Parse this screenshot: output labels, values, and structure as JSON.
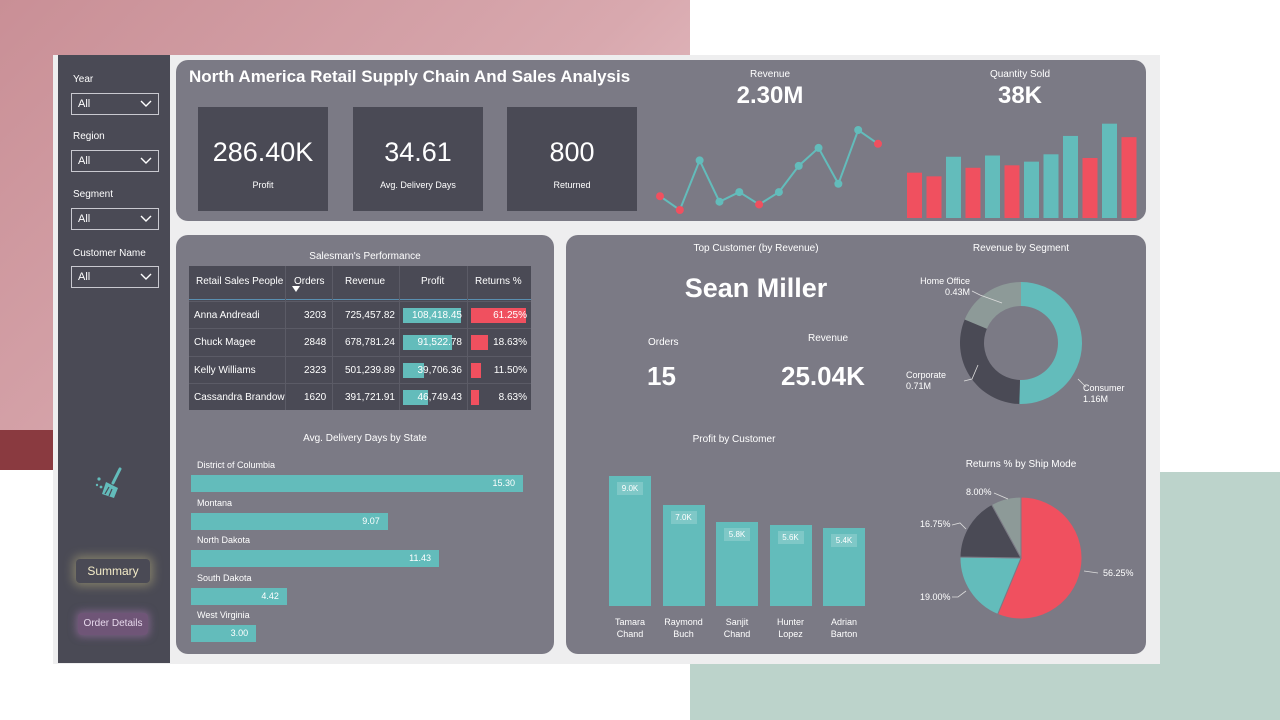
{
  "filters": [
    {
      "label": "Year",
      "value": "All"
    },
    {
      "label": "Region",
      "value": "All"
    },
    {
      "label": "Segment",
      "value": "All"
    },
    {
      "label": "Customer Name",
      "value": "All"
    }
  ],
  "nav": {
    "summary": "Summary",
    "order_details": "Order Details"
  },
  "header": {
    "title": "North America Retail Supply Chain And Sales Analysis",
    "kpis": [
      {
        "value": "286.40K",
        "label": "Profit"
      },
      {
        "value": "34.61",
        "label": "Avg. Delivery Days"
      },
      {
        "value": "800",
        "label": "Returned"
      }
    ],
    "revenue": {
      "label": "Revenue",
      "value": "2.30M"
    },
    "quantity": {
      "label": "Quantity Sold",
      "value": "38K"
    }
  },
  "revenue_trend": {
    "values": [
      3.0,
      2.0,
      5.6,
      2.6,
      3.3,
      2.4,
      3.3,
      5.2,
      6.5,
      3.9,
      7.8,
      6.8
    ],
    "colors": [
      "#f0505f",
      "#f0505f",
      "#63bcbb",
      "#63bcbb",
      "#63bcbb",
      "#f0505f",
      "#63bcbb",
      "#63bcbb",
      "#63bcbb",
      "#63bcbb",
      "#63bcbb",
      "#f0505f"
    ]
  },
  "quantity_bars": {
    "values": [
      37,
      34,
      50,
      41,
      51,
      43,
      46,
      52,
      67,
      49,
      77,
      66
    ],
    "colors": [
      "#f0505f",
      "#f0505f",
      "#63bcbb",
      "#f0505f",
      "#63bcbb",
      "#f0505f",
      "#63bcbb",
      "#63bcbb",
      "#63bcbb",
      "#f0505f",
      "#63bcbb",
      "#f0505f"
    ]
  },
  "salesman": {
    "title": "Salesman's Performance",
    "columns": [
      "Retail Sales People",
      "Orders",
      "Revenue",
      "Profit",
      "Returns %"
    ],
    "rows": [
      {
        "name": "Anna Andreadi",
        "orders": "3203",
        "revenue": "725,457.82",
        "profit": "108,418.45",
        "returns": "61.25%",
        "profit_frac": 1.0,
        "returns_frac": 1.0
      },
      {
        "name": "Chuck Magee",
        "orders": "2848",
        "revenue": "678,781.24",
        "profit": "91,522.78",
        "returns": "18.63%",
        "profit_frac": 0.84,
        "returns_frac": 0.3
      },
      {
        "name": "Kelly Williams",
        "orders": "2323",
        "revenue": "501,239.89",
        "profit": "39,706.36",
        "returns": "11.50%",
        "profit_frac": 0.37,
        "returns_frac": 0.19
      },
      {
        "name": "Cassandra Brandow",
        "orders": "1620",
        "revenue": "391,721.91",
        "profit": "46,749.43",
        "returns": "8.63%",
        "profit_frac": 0.43,
        "returns_frac": 0.14
      }
    ]
  },
  "delivery": {
    "title": "Avg. Delivery Days by State",
    "states": [
      {
        "name": "District of Columbia",
        "value": "15.30"
      },
      {
        "name": "Montana",
        "value": "9.07"
      },
      {
        "name": "North Dakota",
        "value": "11.43"
      },
      {
        "name": "South Dakota",
        "value": "4.42"
      },
      {
        "name": "West Virginia",
        "value": "3.00"
      }
    ],
    "max": 15.3
  },
  "top_customer": {
    "title": "Top Customer (by Revenue)",
    "name": "Sean Miller",
    "orders_label": "Orders",
    "orders": "15",
    "revenue_label": "Revenue",
    "revenue": "25.04K"
  },
  "profit_by_customer": {
    "title": "Profit by Customer",
    "customers": [
      {
        "name1": "Tamara",
        "name2": "Chand",
        "label": "9.0K",
        "value": 9.0
      },
      {
        "name1": "Raymond",
        "name2": "Buch",
        "label": "7.0K",
        "value": 7.0
      },
      {
        "name1": "Sanjit",
        "name2": "Chand",
        "label": "5.8K",
        "value": 5.8
      },
      {
        "name1": "Hunter",
        "name2": "Lopez",
        "label": "5.6K",
        "value": 5.6
      },
      {
        "name1": "Adrian",
        "name2": "Barton",
        "label": "5.4K",
        "value": 5.4
      }
    ]
  },
  "segment": {
    "title": "Revenue by Segment",
    "slices": [
      {
        "name": "Consumer",
        "value": "1.16M",
        "amount": 1.16,
        "color": "#63bcbb"
      },
      {
        "name": "Corporate",
        "value": "0.71M",
        "amount": 0.71,
        "color": "#4a4a55"
      },
      {
        "name": "Home Office",
        "value": "0.43M",
        "amount": 0.43,
        "color": "#8d9a98"
      }
    ]
  },
  "ship_mode": {
    "title": "Returns % by Ship Mode",
    "slices": [
      {
        "label": "56.25%",
        "value": 56.25,
        "color": "#f0505f"
      },
      {
        "label": "19.00%",
        "value": 19.0,
        "color": "#63bcbb"
      },
      {
        "label": "16.75%",
        "value": 16.75,
        "color": "#4a4a55"
      },
      {
        "label": "8.00%",
        "value": 8.0,
        "color": "#8d9a98"
      }
    ]
  }
}
